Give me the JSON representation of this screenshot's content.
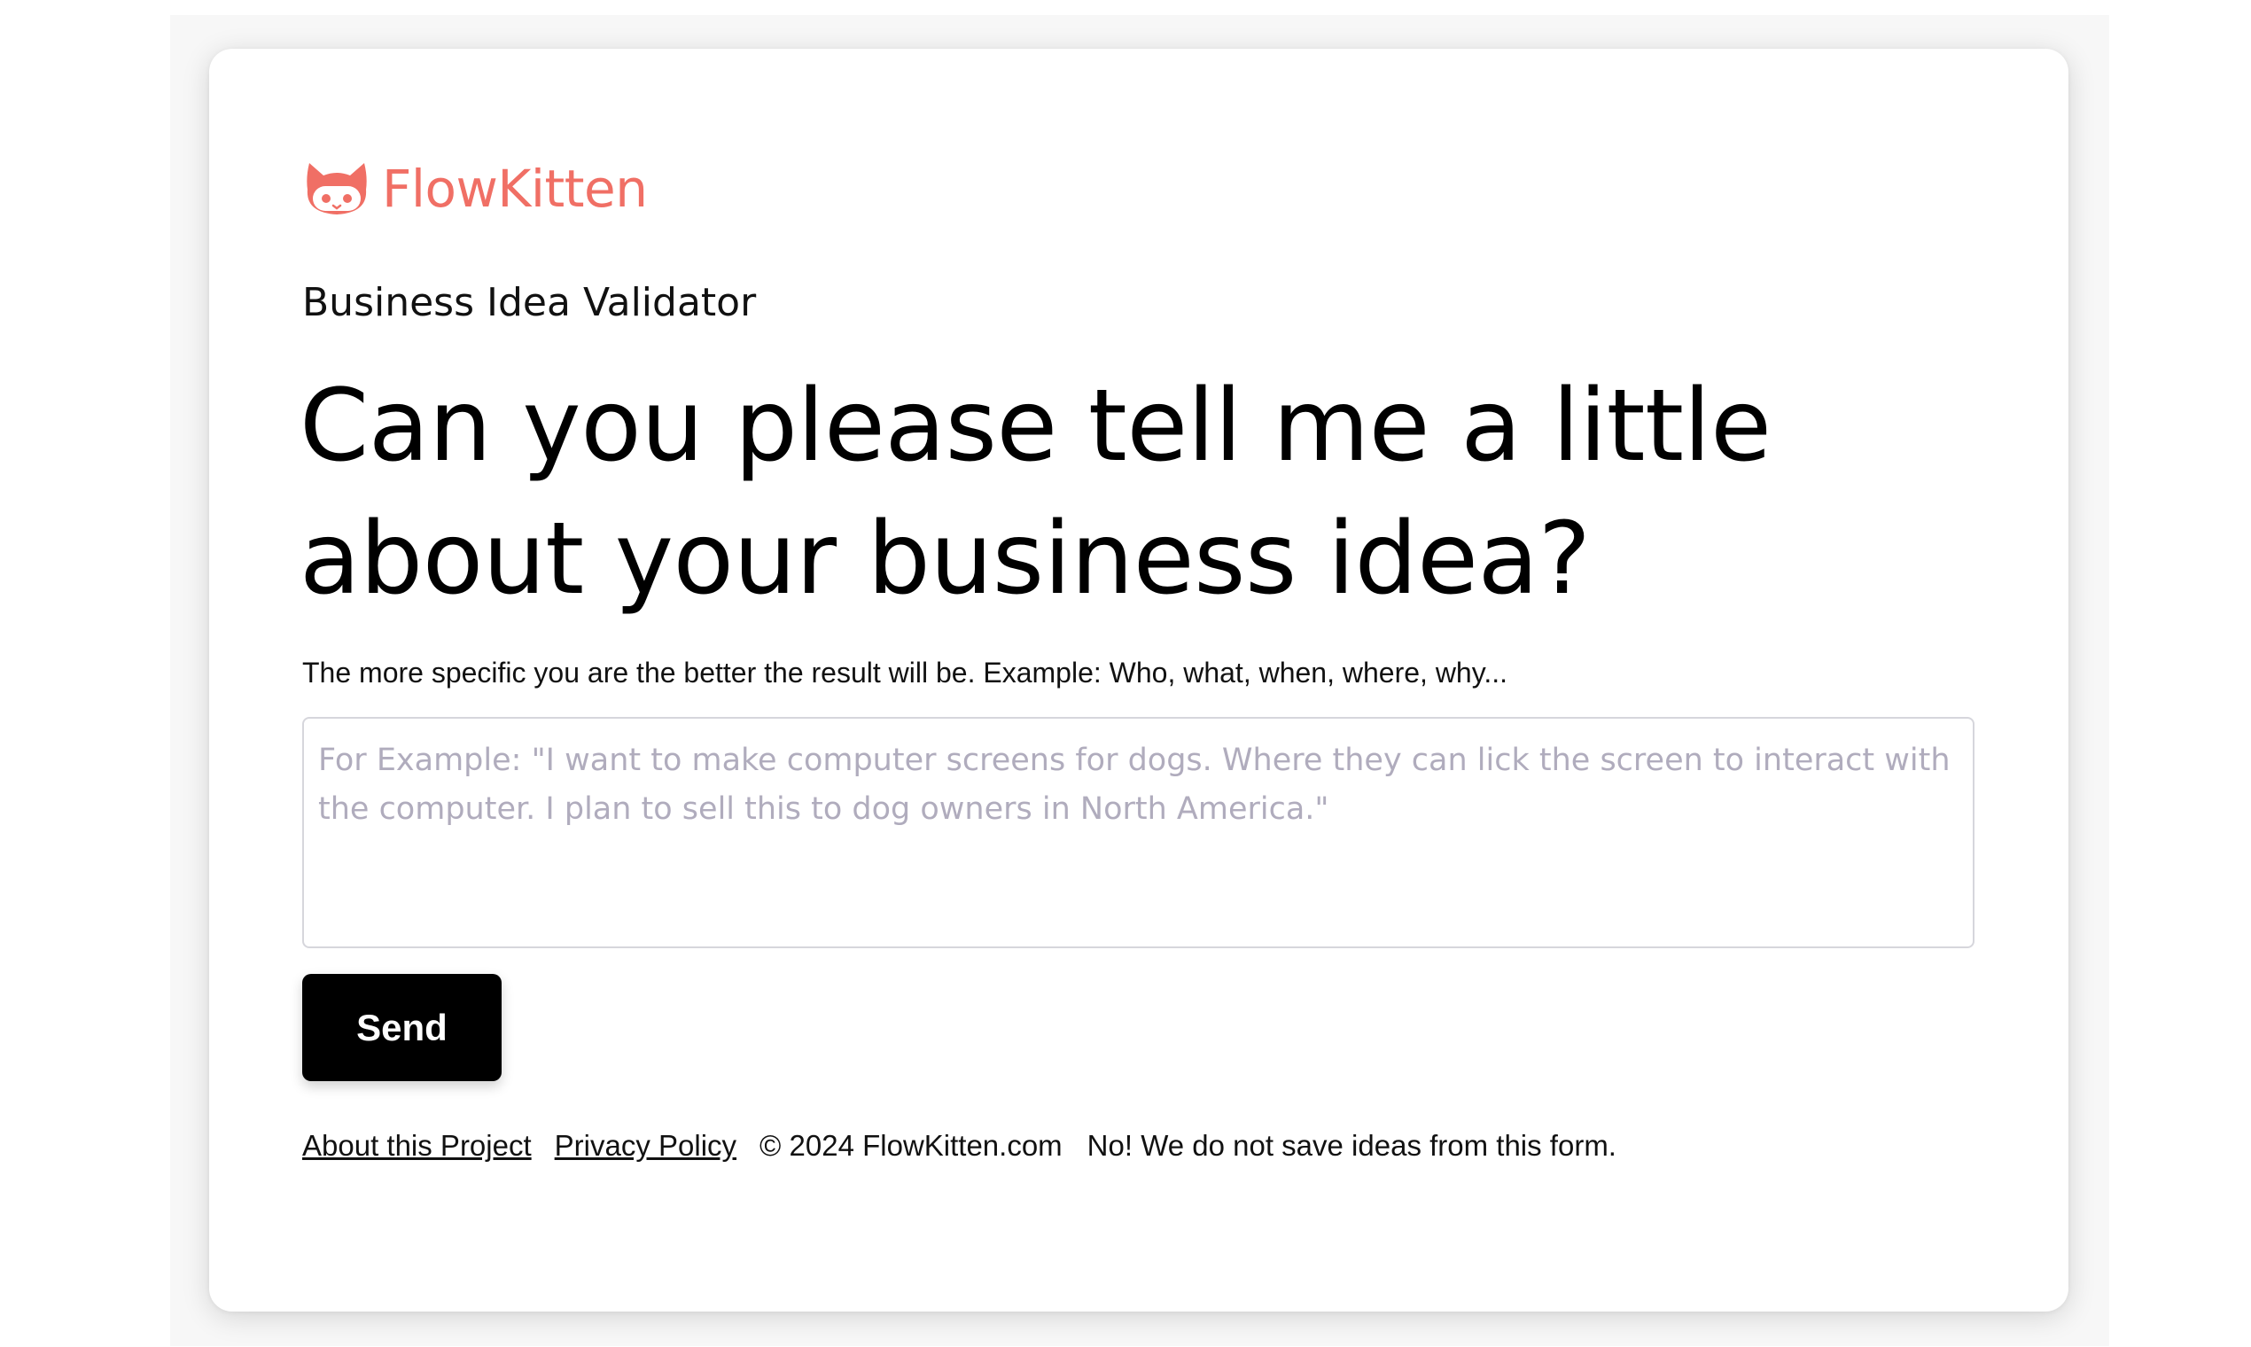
{
  "brand": {
    "name": "FlowKitten",
    "logo_icon": "cat-face-icon",
    "color": "#f06f65"
  },
  "app": {
    "subtitle": "Business Idea Validator"
  },
  "question": {
    "headline": "Can you please tell me a little about your business idea?",
    "helper_text": "The more specific you are the better the result will be. Example: Who, what, when, where, why..."
  },
  "idea_input": {
    "value": "",
    "placeholder": "For Example: \"I want to make computer screens for dogs. Where they can lick the screen to interact with the computer. I plan to sell this to dog owners in North America.\""
  },
  "actions": {
    "send_label": "Send"
  },
  "footer": {
    "about_link": "About this Project",
    "privacy_link": "Privacy Policy",
    "copyright": "© 2024 FlowKitten.com",
    "notice": "No! We do not save ideas from this form."
  }
}
